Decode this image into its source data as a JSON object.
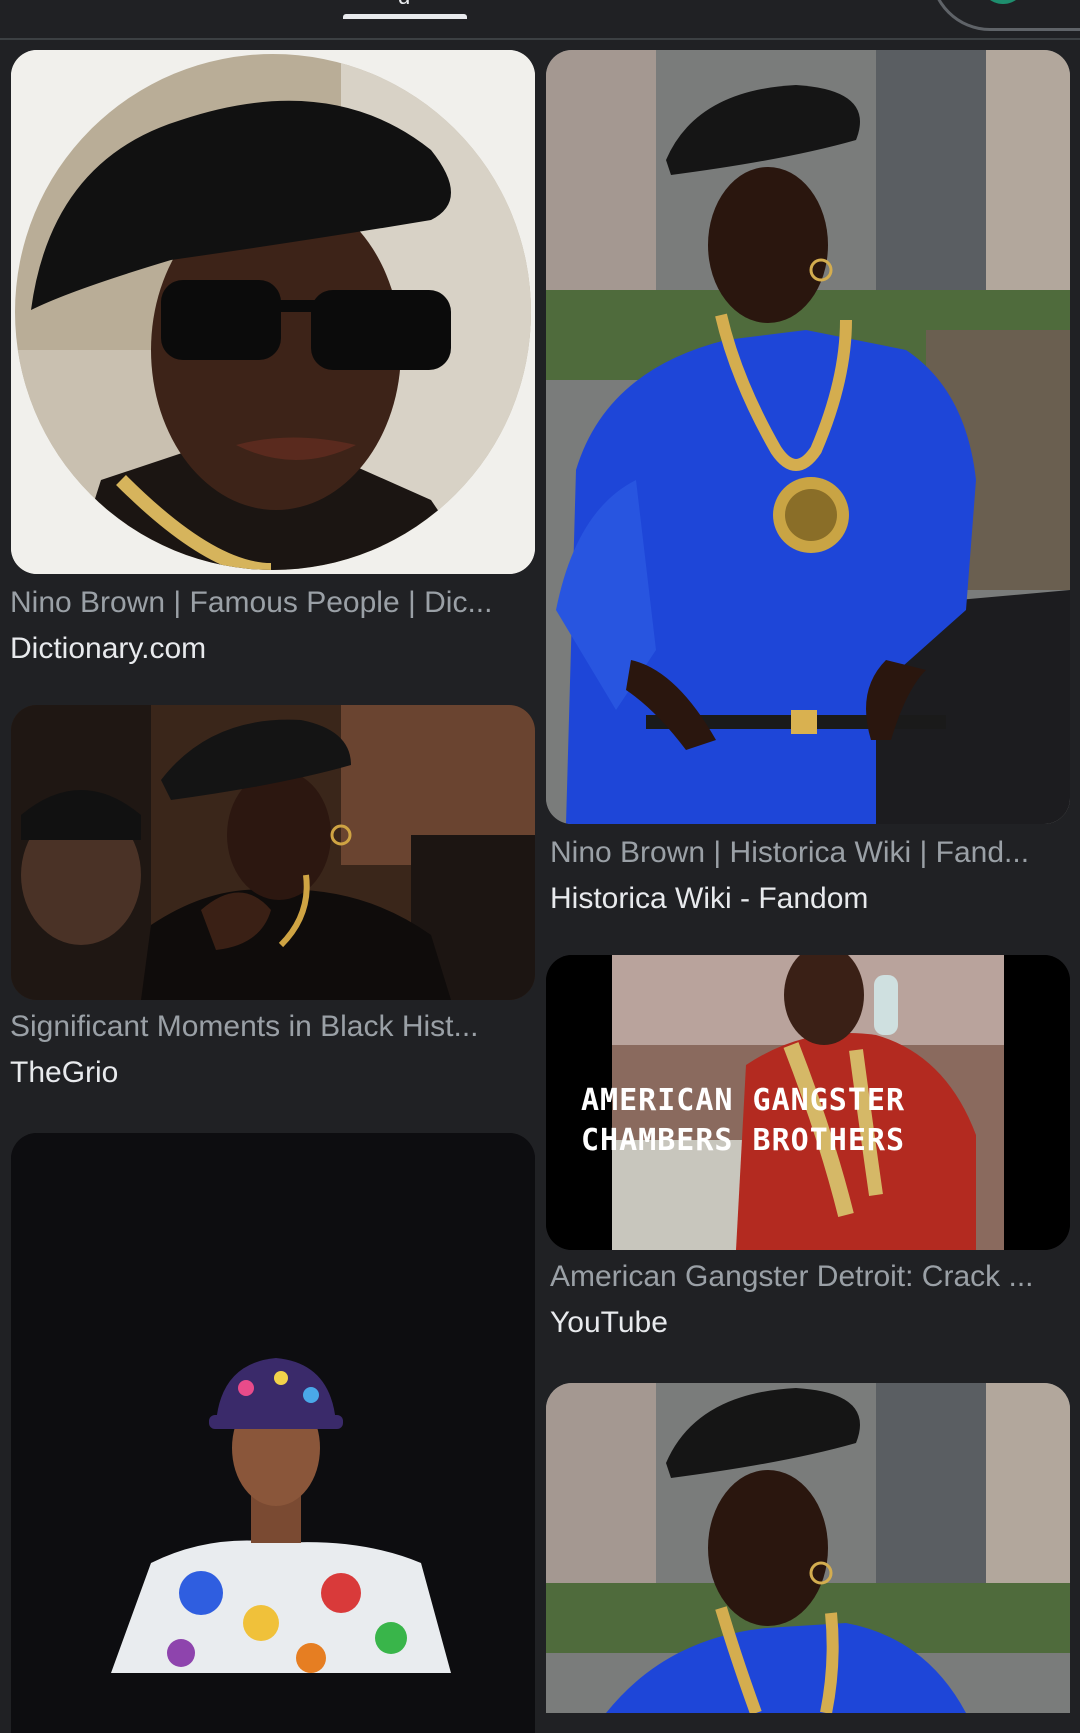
{
  "header": {
    "tab_glyph": "g"
  },
  "results": [
    {
      "title": "Nino Brown | Famous People | Dic...",
      "source": "Dictionary.com"
    },
    {
      "title": "Nino Brown | Historica Wiki | Fand...",
      "source": "Historica Wiki - Fandom"
    },
    {
      "title": "Significant Moments in Black Hist...",
      "source": "TheGrio"
    },
    {
      "title": "American Gangster Detroit: Crack ...",
      "source": "YouTube",
      "overlay_line1": "AMERICAN GANGSTER",
      "overlay_line2": "CHAMBERS BROTHERS"
    },
    {
      "title": "",
      "source": ""
    },
    {
      "title": "",
      "source": ""
    }
  ],
  "colors": {
    "background": "#202124",
    "caption": "#9aa0a6",
    "source": "#e8eaed"
  }
}
